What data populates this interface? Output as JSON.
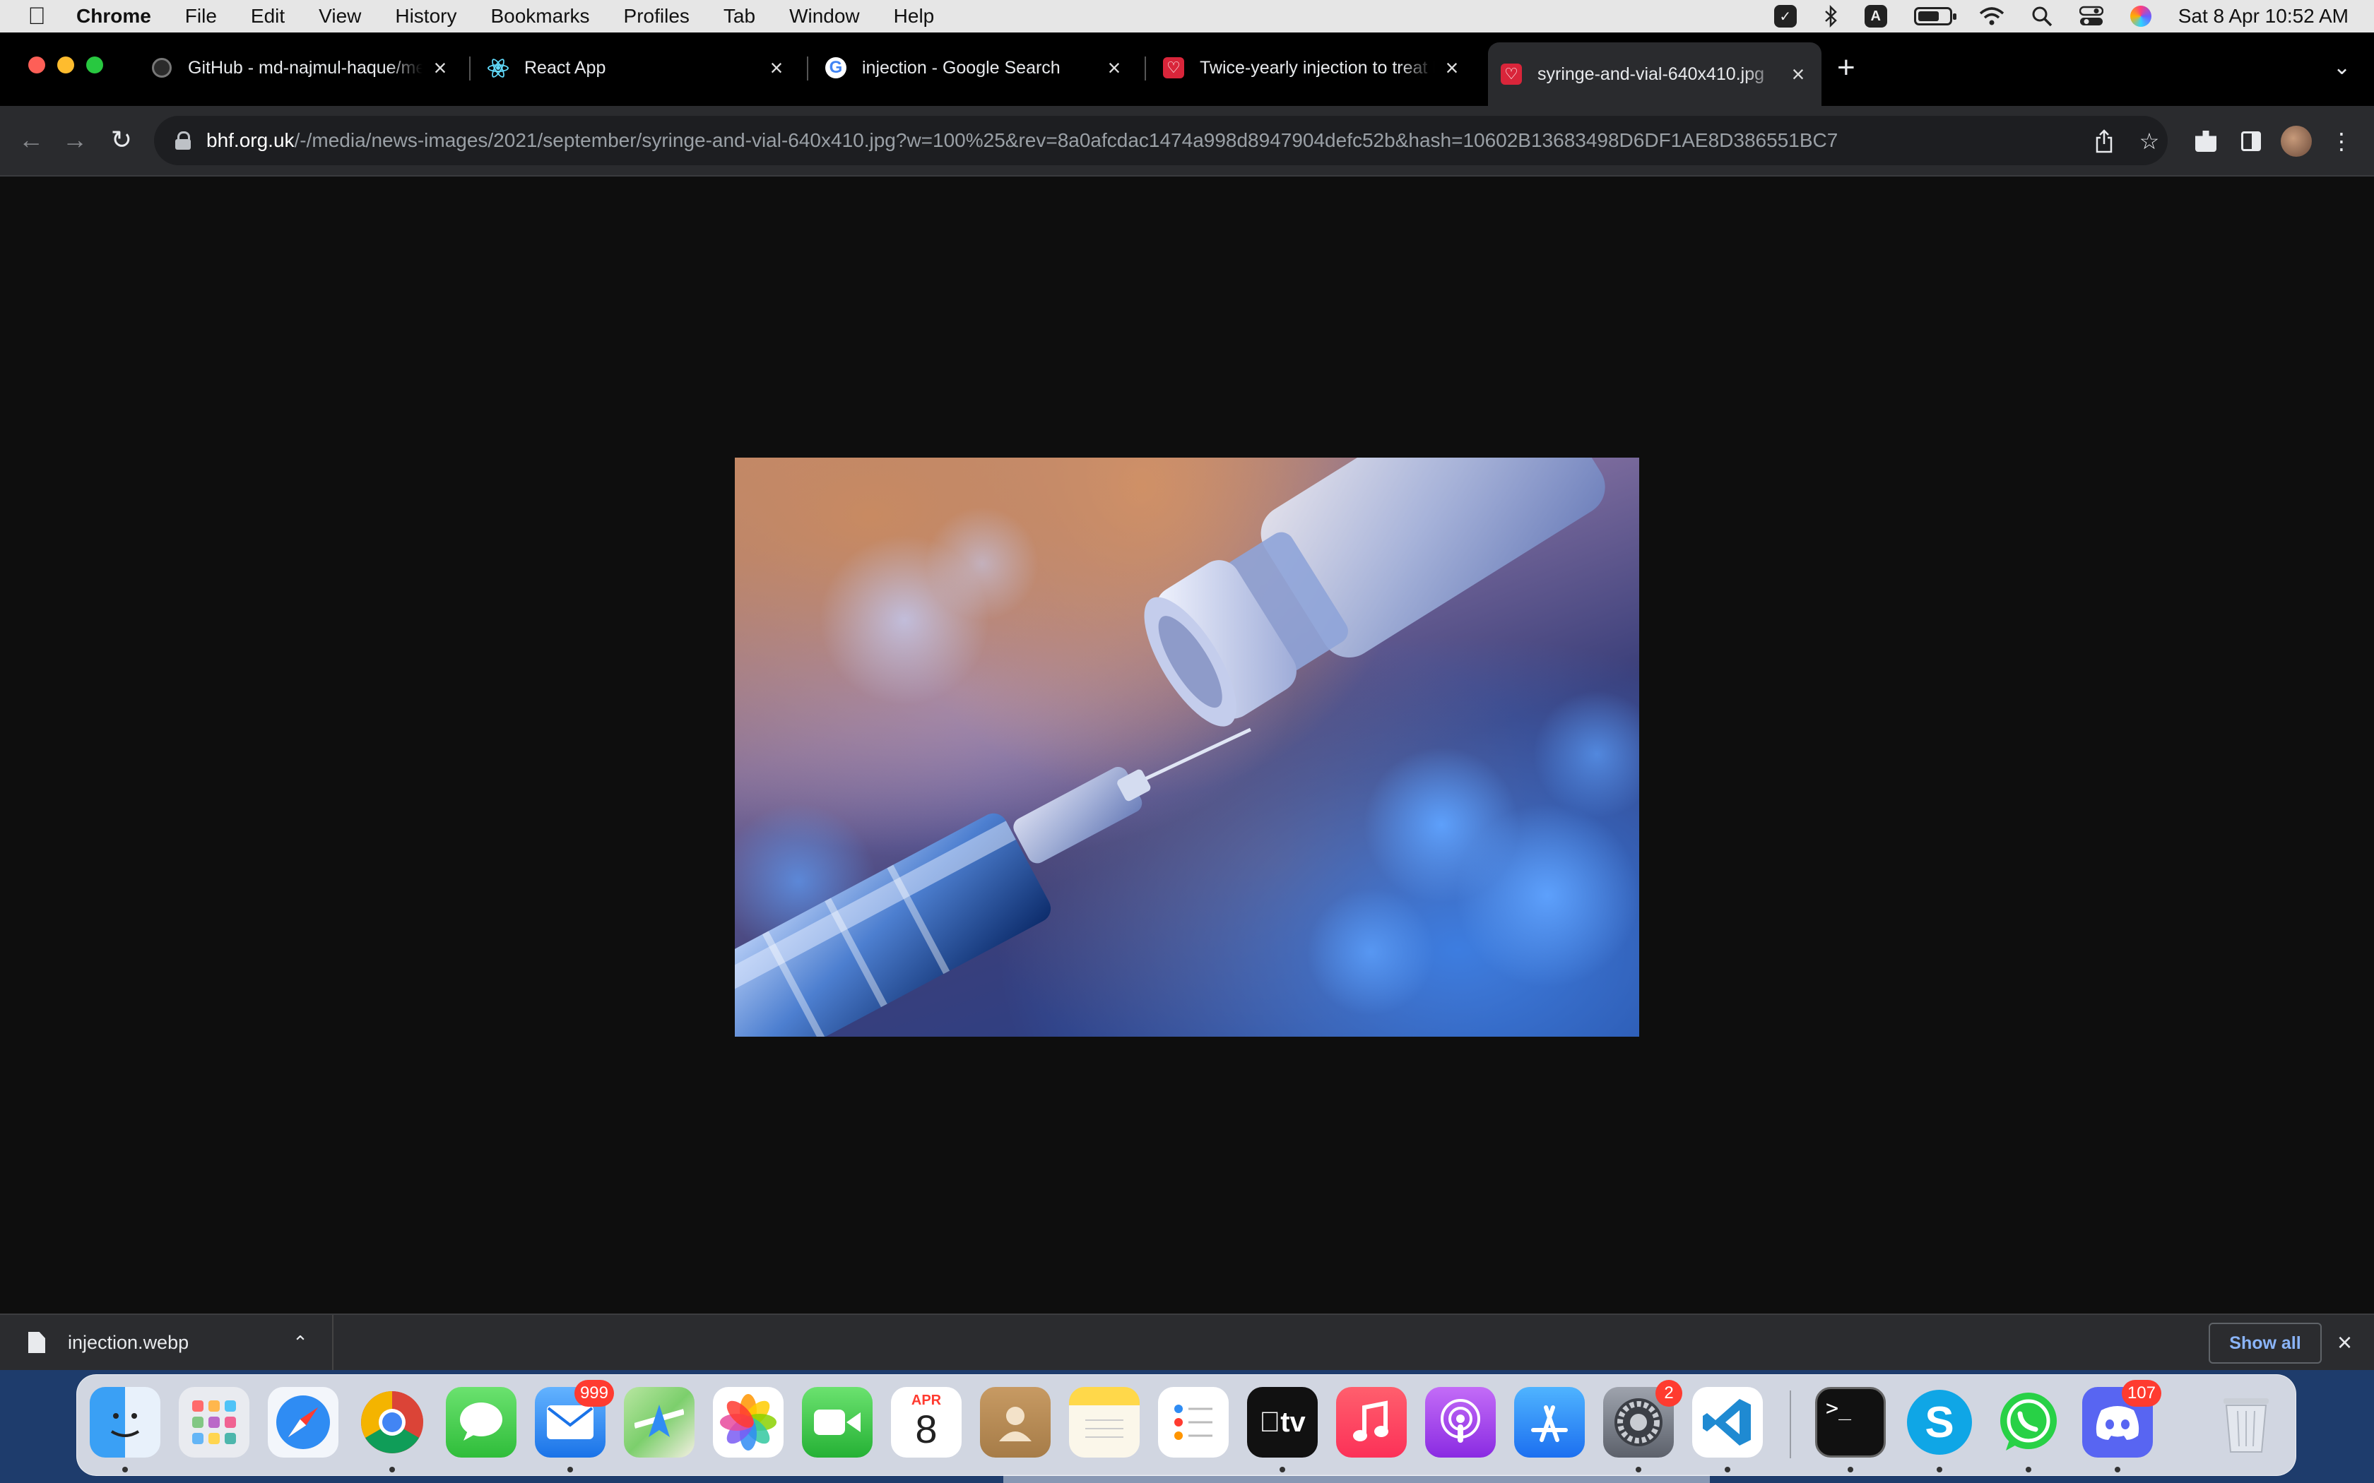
{
  "menubar": {
    "app_name": "Chrome",
    "menus": [
      "File",
      "Edit",
      "View",
      "History",
      "Bookmarks",
      "Profiles",
      "Tab",
      "Window",
      "Help"
    ],
    "status_icons": [
      "checkbox-icon",
      "bluetooth-icon",
      "input-source-icon",
      "battery-icon",
      "wifi-icon",
      "spotlight-icon",
      "control-center-icon",
      "siri-icon"
    ],
    "input_source_letter": "A",
    "clock": "Sat 8 Apr  10:52 AM"
  },
  "tabs": [
    {
      "title": "GitHub - md-najmul-haque/me",
      "favicon": "github-icon"
    },
    {
      "title": "React App",
      "favicon": "react-icon"
    },
    {
      "title": "injection - Google Search",
      "favicon": "google-icon"
    },
    {
      "title": "Twice-yearly injection to treat h",
      "favicon": "bhf-icon"
    },
    {
      "title": "syringe-and-vial-640x410.jpg",
      "favicon": "bhf-icon",
      "active": true
    }
  ],
  "google_glyph": "G",
  "address": {
    "domain": "bhf.org.uk",
    "path": "/-/media/news-images/2021/september/syringe-and-vial-640x410.jpg?w=100%25&rev=8a0afcdac1474a998d8947904defc52b&hash=10602B13683498D6DF1AE8D386551BC7"
  },
  "downloads": {
    "file_name": "injection.webp",
    "show_all_label": "Show all"
  },
  "dock": {
    "apps": [
      {
        "name": "Finder",
        "icon": "finder-icon",
        "running": true
      },
      {
        "name": "Launchpad",
        "icon": "launchpad-icon",
        "running": false
      },
      {
        "name": "Safari",
        "icon": "safari-icon",
        "running": false
      },
      {
        "name": "Google Chrome",
        "icon": "chrome-icon",
        "running": true
      },
      {
        "name": "Messages",
        "icon": "messages-icon",
        "running": false
      },
      {
        "name": "Mail",
        "icon": "mail-icon",
        "running": true,
        "badge": "999"
      },
      {
        "name": "Maps",
        "icon": "maps-icon",
        "running": false
      },
      {
        "name": "Photos",
        "icon": "photos-icon",
        "running": false
      },
      {
        "name": "FaceTime",
        "icon": "facetime-icon",
        "running": false
      },
      {
        "name": "Calendar",
        "icon": "calendar-icon",
        "running": false,
        "month": "APR",
        "day": "8"
      },
      {
        "name": "Contacts",
        "icon": "contacts-icon",
        "running": false
      },
      {
        "name": "Notes",
        "icon": "notes-icon",
        "running": false
      },
      {
        "name": "Reminders",
        "icon": "reminders-icon",
        "running": false
      },
      {
        "name": "Apple TV",
        "icon": "tv-icon",
        "running": true,
        "label": "tv"
      },
      {
        "name": "Music",
        "icon": "music-icon",
        "running": false
      },
      {
        "name": "Podcasts",
        "icon": "podcasts-icon",
        "running": false
      },
      {
        "name": "App Store",
        "icon": "app-store-icon",
        "running": false
      },
      {
        "name": "System Preferences",
        "icon": "settings-icon",
        "running": true,
        "badge": "2"
      },
      {
        "name": "Visual Studio Code",
        "icon": "vscode-icon",
        "running": true
      },
      {
        "name": "Terminal",
        "icon": "terminal-icon",
        "running": true,
        "prompt": ">_"
      },
      {
        "name": "Skype",
        "icon": "skype-icon",
        "running": true,
        "letter": "S"
      },
      {
        "name": "WhatsApp",
        "icon": "whatsapp-icon",
        "running": true
      },
      {
        "name": "Discord",
        "icon": "discord-icon",
        "running": true,
        "badge": "107"
      },
      {
        "name": "Trash",
        "icon": "trash-icon",
        "running": false
      }
    ]
  },
  "colors": {
    "accent_link": "#8ab4f8",
    "badge_red": "#ff3b30",
    "tab_active": "#2a2b2e",
    "page_background": "#0e0e0e"
  }
}
